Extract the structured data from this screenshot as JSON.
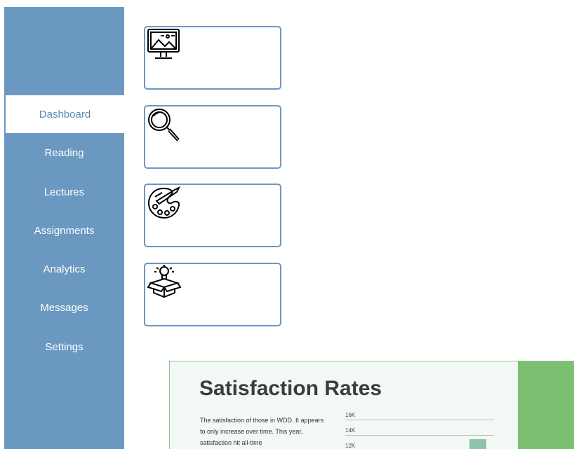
{
  "sidebar": {
    "items": [
      {
        "label": "Dashboard",
        "active": true
      },
      {
        "label": "Reading"
      },
      {
        "label": "Lectures"
      },
      {
        "label": "Assignments"
      },
      {
        "label": "Analytics"
      },
      {
        "label": "Messages"
      },
      {
        "label": "Settings"
      }
    ]
  },
  "cards": [
    {
      "icon": "monitor-image-icon"
    },
    {
      "icon": "magnifier-icon"
    },
    {
      "icon": "palette-icon"
    },
    {
      "icon": "idea-box-icon"
    }
  ],
  "preview": {
    "title": "Satisfaction Rates",
    "paragraph": "The satisfaction of those in WDD. It appears to only increase over time. This year, satisfaction hit all-time",
    "colors": {
      "band": "#7cbf73",
      "bar": "#8fc2a8"
    }
  },
  "chart_data": {
    "type": "bar",
    "y_ticks": [
      "16K",
      "14K",
      "12K"
    ],
    "values": [
      13500
    ]
  },
  "colors": {
    "sidebar": "#6b98c0",
    "active_text": "#5b87b3"
  }
}
